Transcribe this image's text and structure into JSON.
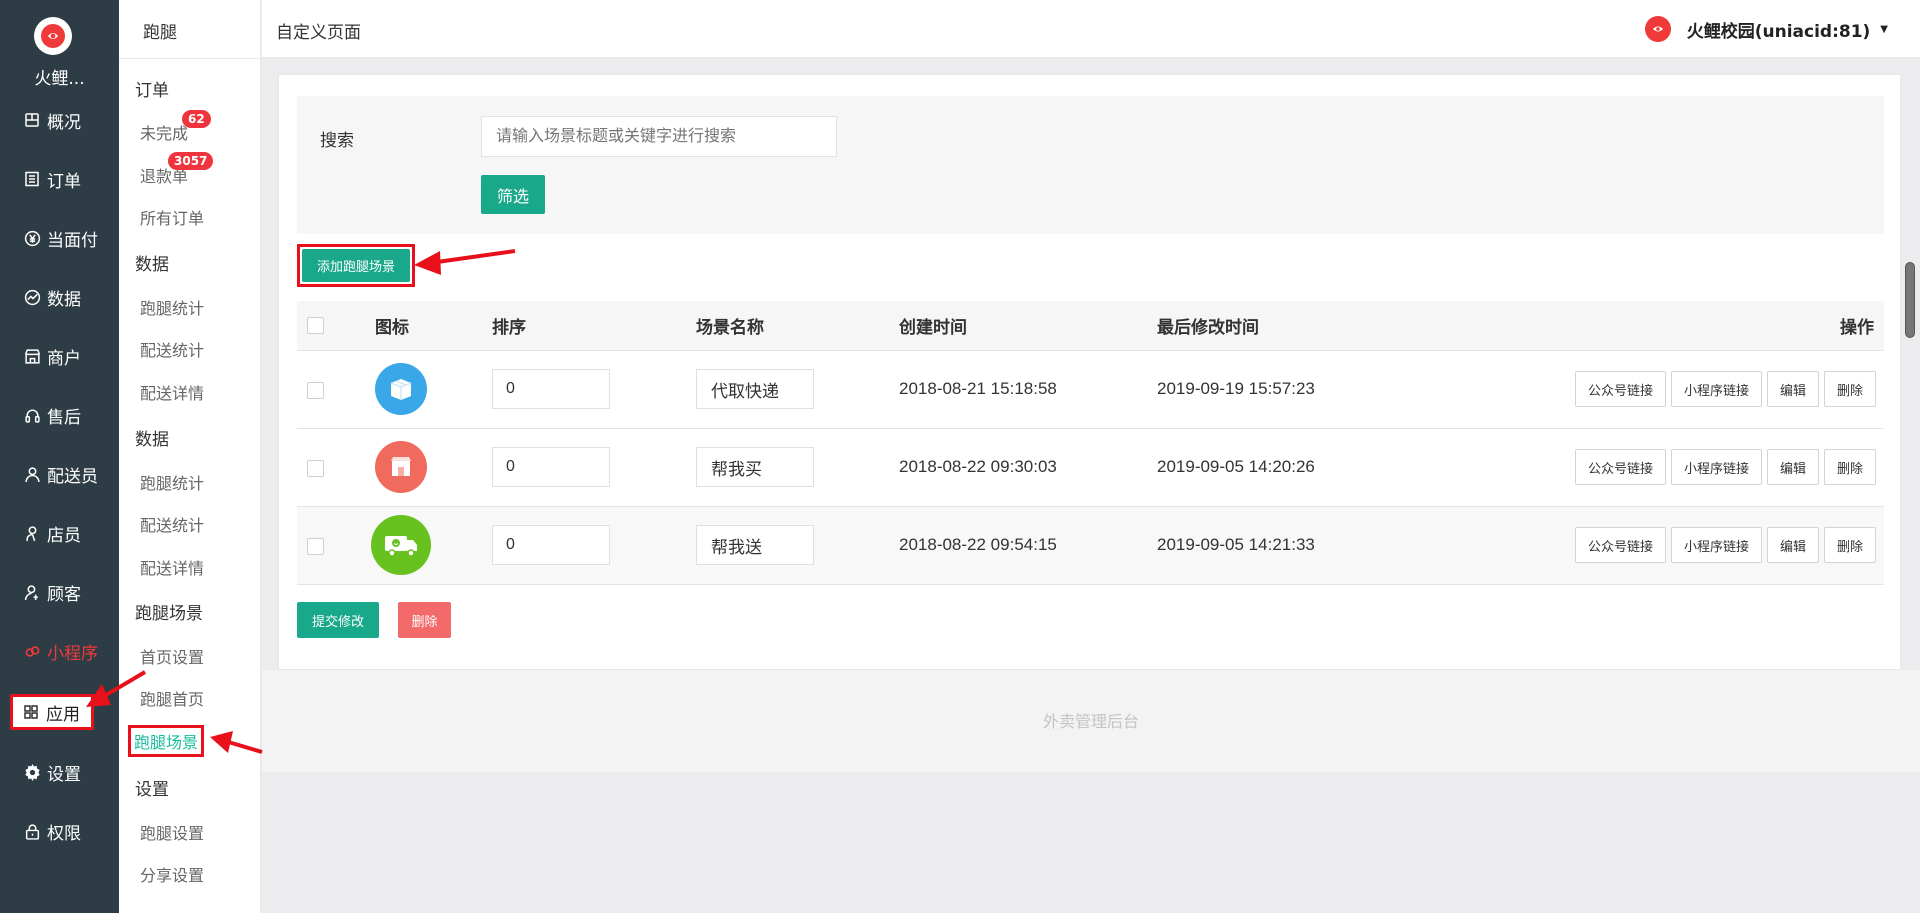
{
  "app": {
    "name": "火鲤...",
    "account": "火鲤校园(uniacid:81)"
  },
  "nav": {
    "items": [
      {
        "label": "概况",
        "icon": "overview-icon"
      },
      {
        "label": "订单",
        "icon": "order-icon"
      },
      {
        "label": "当面付",
        "icon": "yuan-icon"
      },
      {
        "label": "数据",
        "icon": "chart-icon"
      },
      {
        "label": "商户",
        "icon": "store-icon"
      },
      {
        "label": "售后",
        "icon": "headset-icon"
      },
      {
        "label": "配送员",
        "icon": "user-icon"
      },
      {
        "label": "店员",
        "icon": "staff-icon"
      },
      {
        "label": "顾客",
        "icon": "customer-icon"
      },
      {
        "label": "小程序",
        "icon": "miniprogram-icon"
      },
      {
        "label": "应用",
        "icon": "apps-icon"
      },
      {
        "label": "设置",
        "icon": "gear-icon"
      },
      {
        "label": "权限",
        "icon": "lock-icon"
      }
    ]
  },
  "subnav": {
    "title": "跑腿",
    "sections": [
      {
        "head": "订单",
        "links": [
          "未完成",
          "退款单",
          "所有订单"
        ]
      },
      {
        "head": "数据",
        "links": [
          "跑腿统计",
          "配送统计",
          "配送详情"
        ]
      },
      {
        "head": "数据",
        "links": [
          "跑腿统计",
          "配送统计",
          "配送详情"
        ]
      },
      {
        "head": "跑腿场景",
        "links": [
          "首页设置",
          "跑腿首页",
          "跑腿场景"
        ]
      },
      {
        "head": "设置",
        "links": [
          "跑腿设置",
          "分享设置"
        ]
      }
    ],
    "badges": {
      "unfinished": "62",
      "refund": "3057"
    }
  },
  "topbar": {
    "page_title": "自定义页面"
  },
  "search": {
    "label": "搜索",
    "placeholder": "请输入场景标题或关键字进行搜索",
    "filter_label": "筛选"
  },
  "add_button_label": "添加跑腿场景",
  "table": {
    "headers": [
      "图标",
      "排序",
      "场景名称",
      "创建时间",
      "最后修改时间",
      "操作"
    ],
    "rows": [
      {
        "icon": "box-icon",
        "icon_color": "#3aa7e8",
        "sort": "0",
        "name": "代取快递",
        "created": "2018-08-21 15:18:58",
        "modified": "2019-09-19 15:57:23"
      },
      {
        "icon": "shop-icon",
        "icon_color": "#f06a5d",
        "sort": "0",
        "name": "帮我买",
        "created": "2018-08-22 09:30:03",
        "modified": "2019-09-05 14:20:26"
      },
      {
        "icon": "truck-icon",
        "icon_color": "#67c11f",
        "sort": "0",
        "name": "帮我送",
        "created": "2018-08-22 09:54:15",
        "modified": "2019-09-05 14:21:33"
      }
    ],
    "row_actions": [
      "公众号链接",
      "小程序链接",
      "编辑",
      "删除"
    ]
  },
  "submit_label": "提交修改",
  "delete_label": "删除",
  "footer_text": "外卖管理后台",
  "colors": {
    "nav_bg": "#2e3d45",
    "primary": "#1aa88b",
    "danger": "#f36a6a",
    "highlight": "#e8101b"
  }
}
